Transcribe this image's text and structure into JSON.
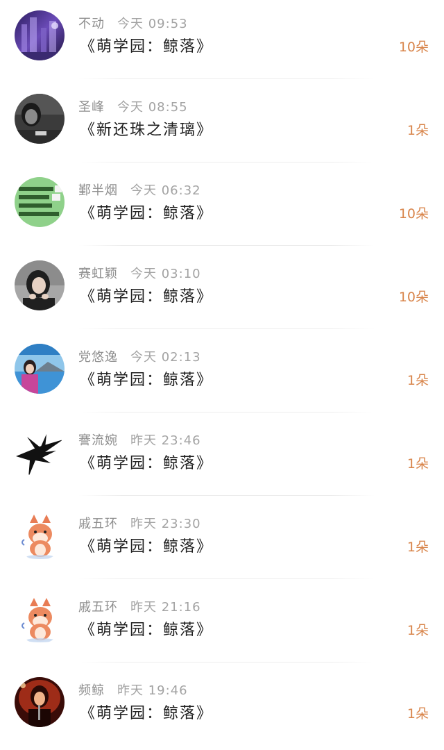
{
  "records": [
    {
      "user": "不动",
      "time": "今天 09:53",
      "gift": "《萌学园：鲸落》",
      "count": "10朵",
      "avatar": "purple-night-avatar"
    },
    {
      "user": "圣峰",
      "time": "今天 08:55",
      "gift": "《新还珠之清璃》",
      "count": "1朵",
      "avatar": "bw-portrait-avatar"
    },
    {
      "user": "鄞半烟",
      "time": "今天 06:32",
      "gift": "《萌学园：鲸落》",
      "count": "10朵",
      "avatar": "green-text-avatar"
    },
    {
      "user": "赛虹颖",
      "time": "今天 03:10",
      "gift": "《萌学园：鲸落》",
      "count": "10朵",
      "avatar": "girl-portrait-avatar"
    },
    {
      "user": "党悠逸",
      "time": "今天 02:13",
      "gift": "《萌学园：鲸落》",
      "count": "1朵",
      "avatar": "lake-photo-avatar"
    },
    {
      "user": "謇流婉",
      "time": "昨天 23:46",
      "gift": "《萌学园：鲸落》",
      "count": "1朵",
      "avatar": "tribal-logo-avatar"
    },
    {
      "user": "戚五环",
      "time": "昨天 23:30",
      "gift": "《萌学园：鲸落》",
      "count": "1朵",
      "avatar": "shiba-dog-avatar"
    },
    {
      "user": "戚五环",
      "time": "昨天 21:16",
      "gift": "《萌学园：鲸落》",
      "count": "1朵",
      "avatar": "shiba-dog-avatar"
    },
    {
      "user": "频鲸",
      "time": "昨天 19:46",
      "gift": "《萌学园：鲸落》",
      "count": "1朵",
      "avatar": "red-concert-avatar"
    }
  ],
  "colors": {
    "count": "#d8844a",
    "name": "#8e8e8e",
    "gift": "#1f1f1f",
    "divider": "#ececec"
  }
}
